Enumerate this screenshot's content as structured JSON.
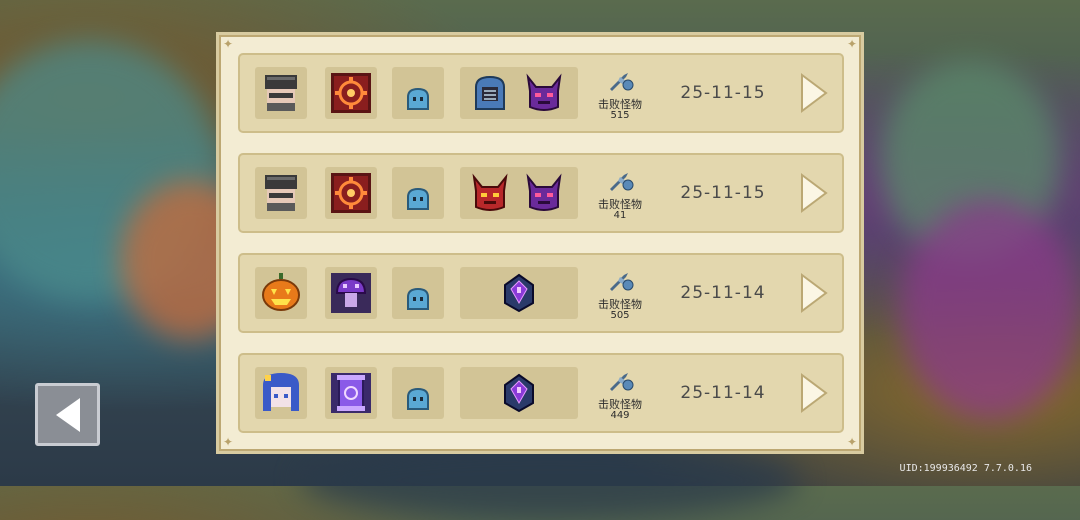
{
  "records": [
    {
      "character_icon": "masked-knight-icon",
      "weapon_icon": "red-rune-icon",
      "pet_icon": "blue-slime-icon",
      "boss_icons": [
        "blue-knight-helmet-icon",
        "purple-demon-icon"
      ],
      "kill_label": "击败怪物",
      "kill_count": "515",
      "date": "25-11-15"
    },
    {
      "character_icon": "masked-knight-icon",
      "weapon_icon": "red-rune-icon",
      "pet_icon": "blue-slime-icon",
      "boss_icons": [
        "red-demon-icon",
        "purple-demon-icon"
      ],
      "kill_label": "击败怪物",
      "kill_count": "41",
      "date": "25-11-15"
    },
    {
      "character_icon": "pumpkin-head-icon",
      "weapon_icon": "purple-mushroom-icon",
      "pet_icon": "blue-slime-icon",
      "boss_icons": [
        "dark-crystal-icon"
      ],
      "kill_label": "击败怪物",
      "kill_count": "505",
      "date": "25-11-14"
    },
    {
      "character_icon": "blue-hair-girl-icon",
      "weapon_icon": "purple-scroll-icon",
      "pet_icon": "blue-slime-icon",
      "boss_icons": [
        "dark-crystal-icon"
      ],
      "kill_label": "击败怪物",
      "kill_count": "449",
      "date": "25-11-14"
    }
  ],
  "footer": {
    "uid": "UID:199936492 7.7.0.16"
  },
  "colors": {
    "panel": "#f3ecd3",
    "row": "#e3d7ae",
    "slot": "#d2c496",
    "slime": "#5aa8d4"
  }
}
